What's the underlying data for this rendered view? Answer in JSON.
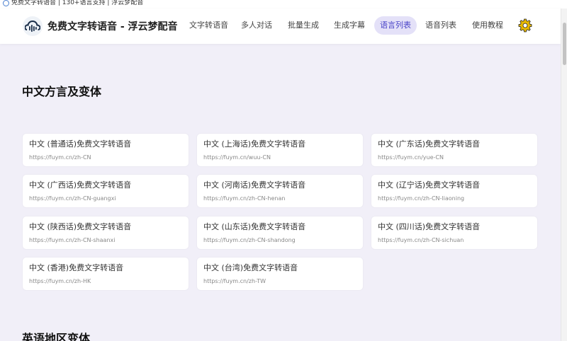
{
  "window": {
    "title": "免费文字转语音 | 130+语言支持 | 浮云梦配音"
  },
  "header": {
    "brand": "免费文字转语音 - 浮云梦配音",
    "nav": [
      {
        "label": "文字转语音"
      },
      {
        "label": "多人对话"
      },
      {
        "label": "批量生成"
      },
      {
        "label": "生成字幕"
      },
      {
        "label": "语言列表",
        "active": true
      },
      {
        "label": "语音列表"
      },
      {
        "label": "使用教程"
      }
    ],
    "settings_icon": "gear-icon",
    "accent_color": "#4a45c8",
    "gear_color": "#e8b800"
  },
  "sections": [
    {
      "title": "中文方言及变体",
      "cards": [
        {
          "name": "中文 (普通话)免费文字转语音",
          "url": "https://fuym.cn/zh-CN"
        },
        {
          "name": "中文 (上海话)免费文字转语音",
          "url": "https://fuym.cn/wuu-CN"
        },
        {
          "name": "中文 (广东话)免费文字转语音",
          "url": "https://fuym.cn/yue-CN"
        },
        {
          "name": "中文 (广西话)免费文字转语音",
          "url": "https://fuym.cn/zh-CN-guangxi"
        },
        {
          "name": "中文 (河南话)免费文字转语音",
          "url": "https://fuym.cn/zh-CN-henan"
        },
        {
          "name": "中文 (辽宁话)免费文字转语音",
          "url": "https://fuym.cn/zh-CN-liaoning"
        },
        {
          "name": "中文 (陕西话)免费文字转语音",
          "url": "https://fuym.cn/zh-CN-shaanxi"
        },
        {
          "name": "中文 (山东话)免费文字转语音",
          "url": "https://fuym.cn/zh-CN-shandong"
        },
        {
          "name": "中文 (四川话)免费文字转语音",
          "url": "https://fuym.cn/zh-CN-sichuan"
        },
        {
          "name": "中文 (香港)免费文字转语音",
          "url": "https://fuym.cn/zh-HK"
        },
        {
          "name": "中文 (台湾)免费文字转语音",
          "url": "https://fuym.cn/zh-TW"
        }
      ]
    },
    {
      "title": "英语地区变体"
    }
  ]
}
